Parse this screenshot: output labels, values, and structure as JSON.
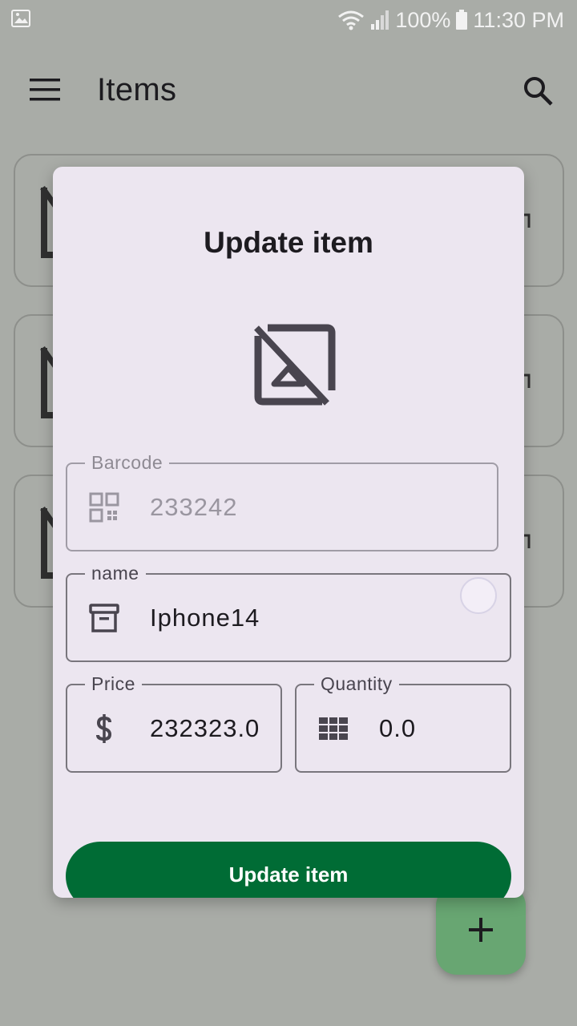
{
  "status_bar": {
    "battery": "100%",
    "time": "11:30 PM",
    "icons": [
      "gallery-icon",
      "wifi-icon",
      "signal-icon",
      "battery-icon"
    ]
  },
  "app_bar": {
    "title": "Items",
    "icons": [
      "menu-icon",
      "search-icon"
    ]
  },
  "dialog": {
    "title": "Update item",
    "image_icon": "hide-image-icon",
    "fields": {
      "barcode": {
        "label": "Barcode",
        "value": "233242",
        "icon": "qr-code-icon",
        "enabled": false
      },
      "name": {
        "label": "name",
        "value": "Iphone14",
        "icon": "archive-box-icon"
      },
      "price": {
        "label": "Price",
        "value": "232323.0",
        "icon": "dollar-icon"
      },
      "quantity": {
        "label": "Quantity",
        "value": "0.0",
        "icon": "grid-icon"
      }
    },
    "submit_label": "Update item"
  },
  "fab": {
    "icon": "plus-icon"
  },
  "colors": {
    "scrim_background": "#a9aca7",
    "dialog_surface": "#ece6f0",
    "primary_button": "#006c35",
    "fab": "#68a672"
  }
}
